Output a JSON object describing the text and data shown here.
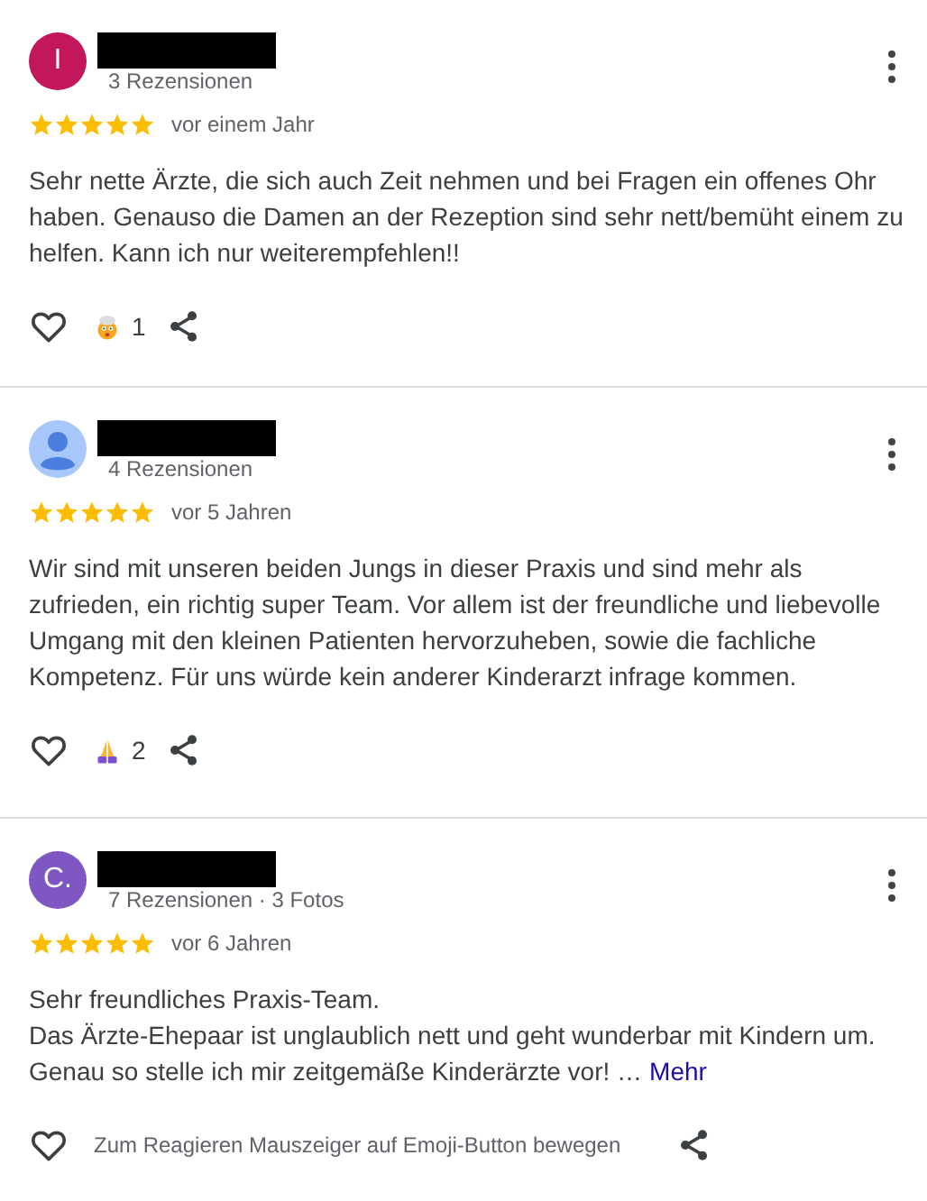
{
  "reviews": [
    {
      "avatar": {
        "kind": "letter",
        "letter": "I",
        "color": "#c2185b"
      },
      "name_redacted": true,
      "meta": "3 Rezensionen",
      "stars": 5,
      "time": "vor einem Jahr",
      "paragraphs": [
        "Sehr nette Ärzte, die sich auch Zeit nehmen und bei Fragen ein offenes Ohr haben. Genauso die Damen an der Rezeption sind sehr nett/bemüht einem zu helfen. Kann ich nur weiterempfehlen!!"
      ],
      "reaction": {
        "kind": "mindblown",
        "count": "1"
      }
    },
    {
      "avatar": {
        "kind": "silhouette",
        "color": "#a8c7fa"
      },
      "name_redacted": true,
      "meta": "4 Rezensionen",
      "stars": 5,
      "time": "vor 5 Jahren",
      "paragraphs": [
        "Wir sind mit unseren beiden Jungs in dieser Praxis und sind mehr als zufrieden, ein richtig super Team. Vor allem ist der freundliche und liebevolle Umgang mit den kleinen Patienten hervorzuheben, sowie die fachliche Kompetenz. Für uns würde kein anderer Kinderarzt infrage kommen."
      ],
      "reaction": {
        "kind": "pray",
        "count": "2"
      }
    },
    {
      "avatar": {
        "kind": "letter",
        "letter": "C.",
        "color": "#7e57c2"
      },
      "name_redacted": true,
      "meta": "7 Rezensionen · 3 Fotos",
      "stars": 5,
      "time": "vor 6 Jahren",
      "paragraphs": [
        "Sehr freundliches Praxis-Team.",
        "Das Ärzte-Ehepaar ist unglaublich nett und geht wunderbar mit Kindern um.",
        "Genau so stelle ich mir zeitgemäße Kinderärzte vor! …"
      ],
      "more_link": "Mehr",
      "reaction_hint": "Zum Reagieren Mauszeiger auf Emoji-Button bewegen"
    }
  ]
}
